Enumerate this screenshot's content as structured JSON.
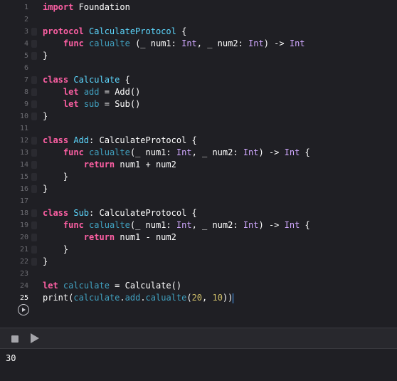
{
  "editor": {
    "current_line": 25,
    "lines": [
      {
        "n": "1",
        "tokens": [
          [
            "kw",
            "import"
          ],
          [
            "plain",
            " Foundation"
          ]
        ]
      },
      {
        "n": "2",
        "tokens": []
      },
      {
        "n": "3",
        "fold": true,
        "tokens": [
          [
            "kw",
            "protocol"
          ],
          [
            "plain",
            " "
          ],
          [
            "type",
            "CalculateProtocol"
          ],
          [
            "plain",
            " {"
          ]
        ]
      },
      {
        "n": "4",
        "fold": true,
        "tokens": [
          [
            "plain",
            "    "
          ],
          [
            "kw",
            "func"
          ],
          [
            "plain",
            " "
          ],
          [
            "ref",
            "calualte"
          ],
          [
            "plain",
            " (_ num1: "
          ],
          [
            "ptype",
            "Int"
          ],
          [
            "plain",
            ", _ num2: "
          ],
          [
            "ptype",
            "Int"
          ],
          [
            "plain",
            ") -> "
          ],
          [
            "ptype",
            "Int"
          ]
        ]
      },
      {
        "n": "5",
        "fold": true,
        "tokens": [
          [
            "plain",
            "}"
          ]
        ]
      },
      {
        "n": "6",
        "tokens": []
      },
      {
        "n": "7",
        "fold": true,
        "tokens": [
          [
            "kw",
            "class"
          ],
          [
            "plain",
            " "
          ],
          [
            "type",
            "Calculate"
          ],
          [
            "plain",
            " {"
          ]
        ]
      },
      {
        "n": "8",
        "fold": true,
        "tokens": [
          [
            "plain",
            "    "
          ],
          [
            "kw",
            "let"
          ],
          [
            "plain",
            " "
          ],
          [
            "ref",
            "add"
          ],
          [
            "plain",
            " = Add()"
          ]
        ]
      },
      {
        "n": "9",
        "fold": true,
        "tokens": [
          [
            "plain",
            "    "
          ],
          [
            "kw",
            "let"
          ],
          [
            "plain",
            " "
          ],
          [
            "ref",
            "sub"
          ],
          [
            "plain",
            " = Sub()"
          ]
        ]
      },
      {
        "n": "10",
        "fold": true,
        "tokens": [
          [
            "plain",
            "}"
          ]
        ]
      },
      {
        "n": "11",
        "tokens": []
      },
      {
        "n": "12",
        "fold": true,
        "tokens": [
          [
            "kw",
            "class"
          ],
          [
            "plain",
            " "
          ],
          [
            "type",
            "Add"
          ],
          [
            "plain",
            ": CalculateProtocol {"
          ]
        ]
      },
      {
        "n": "13",
        "fold": true,
        "tokens": [
          [
            "plain",
            "    "
          ],
          [
            "kw",
            "func"
          ],
          [
            "plain",
            " "
          ],
          [
            "ref",
            "calualte"
          ],
          [
            "plain",
            "(_ num1: "
          ],
          [
            "ptype",
            "Int"
          ],
          [
            "plain",
            ", _ num2: "
          ],
          [
            "ptype",
            "Int"
          ],
          [
            "plain",
            ") -> "
          ],
          [
            "ptype",
            "Int"
          ],
          [
            "plain",
            " {"
          ]
        ]
      },
      {
        "n": "14",
        "fold": true,
        "tokens": [
          [
            "plain",
            "        "
          ],
          [
            "kw",
            "return"
          ],
          [
            "plain",
            " num1 + num2"
          ]
        ]
      },
      {
        "n": "15",
        "fold": true,
        "tokens": [
          [
            "plain",
            "    }"
          ]
        ]
      },
      {
        "n": "16",
        "fold": true,
        "tokens": [
          [
            "plain",
            "}"
          ]
        ]
      },
      {
        "n": "17",
        "tokens": []
      },
      {
        "n": "18",
        "fold": true,
        "tokens": [
          [
            "kw",
            "class"
          ],
          [
            "plain",
            " "
          ],
          [
            "type",
            "Sub"
          ],
          [
            "plain",
            ": CalculateProtocol {"
          ]
        ]
      },
      {
        "n": "19",
        "fold": true,
        "tokens": [
          [
            "plain",
            "    "
          ],
          [
            "kw",
            "func"
          ],
          [
            "plain",
            " "
          ],
          [
            "ref",
            "calualte"
          ],
          [
            "plain",
            "(_ num1: "
          ],
          [
            "ptype",
            "Int"
          ],
          [
            "plain",
            ", _ num2: "
          ],
          [
            "ptype",
            "Int"
          ],
          [
            "plain",
            ") -> "
          ],
          [
            "ptype",
            "Int"
          ],
          [
            "plain",
            " {"
          ]
        ]
      },
      {
        "n": "20",
        "fold": true,
        "tokens": [
          [
            "plain",
            "        "
          ],
          [
            "kw",
            "return"
          ],
          [
            "plain",
            " num1 - num2"
          ]
        ]
      },
      {
        "n": "21",
        "fold": true,
        "tokens": [
          [
            "plain",
            "    }"
          ]
        ]
      },
      {
        "n": "22",
        "fold": true,
        "tokens": [
          [
            "plain",
            "}"
          ]
        ]
      },
      {
        "n": "23",
        "tokens": []
      },
      {
        "n": "24",
        "tokens": [
          [
            "kw",
            "let"
          ],
          [
            "plain",
            " "
          ],
          [
            "ref",
            "calculate"
          ],
          [
            "plain",
            " = Calculate()"
          ]
        ]
      },
      {
        "n": "25",
        "tokens": [
          [
            "plain",
            "print("
          ],
          [
            "ref",
            "calculate"
          ],
          [
            "plain",
            "."
          ],
          [
            "ref",
            "add"
          ],
          [
            "plain",
            "."
          ],
          [
            "ref",
            "calualte"
          ],
          [
            "plain",
            "("
          ],
          [
            "num",
            "20"
          ],
          [
            "plain",
            ", "
          ],
          [
            "num",
            "10"
          ],
          [
            "plain",
            "))"
          ]
        ]
      }
    ]
  },
  "colors": {
    "background": "#1f1f24",
    "keyword": "#fc5fa3",
    "type_declaration": "#5dd8ff",
    "reference": "#41a1c0",
    "project_type": "#d0a8ff",
    "number": "#d0bf69",
    "plain": "#ffffff",
    "line_number": "#6c6c72",
    "cursor": "#4aa3ff"
  },
  "icons": {
    "run_line": "play-circle-icon",
    "stop": "stop-square-icon",
    "play": "play-triangle-icon"
  },
  "console": {
    "output": "30"
  }
}
